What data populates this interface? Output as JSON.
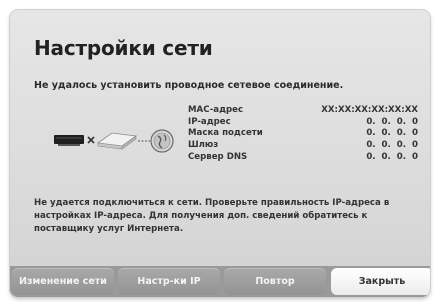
{
  "dialog": {
    "title": "Настройки сети",
    "subtitle": "Не удалось установить проводное сетевое соединение.",
    "message": "Не удается подключиться к сети. Проверьте правильность IP-адреса в настройках IP-адреса. Для получения доп. сведений обратитесь к поставщику услуг Интернета."
  },
  "network_info": {
    "rows": [
      {
        "label": "MAC-адрес",
        "value": "XX:XX:XX:XX:XX:XX"
      },
      {
        "label": "IP-адрес",
        "value": "0.  0.  0.  0"
      },
      {
        "label": "Маска подсети",
        "value": "0.  0.  0.  0"
      },
      {
        "label": "Шлюз",
        "value": "0.  0.  0.  0"
      },
      {
        "label": "Сервер DNS",
        "value": "0.  0.  0.  0"
      }
    ]
  },
  "diagram": {
    "icons": [
      "tv-device-icon",
      "disconnected-x-icon",
      "router-icon",
      "globe-icon"
    ]
  },
  "buttons": [
    {
      "label": "Изменение сети",
      "active": false
    },
    {
      "label": "Настр-ки IP",
      "active": false
    },
    {
      "label": "Повтор",
      "active": false
    },
    {
      "label": "Закрыть",
      "active": true
    }
  ],
  "colors": {
    "dialog_bg": "#dedede",
    "button_bar": "#9a9a9a",
    "button": "#9f9f9f",
    "button_active": "#ffffff",
    "text": "#333333"
  }
}
